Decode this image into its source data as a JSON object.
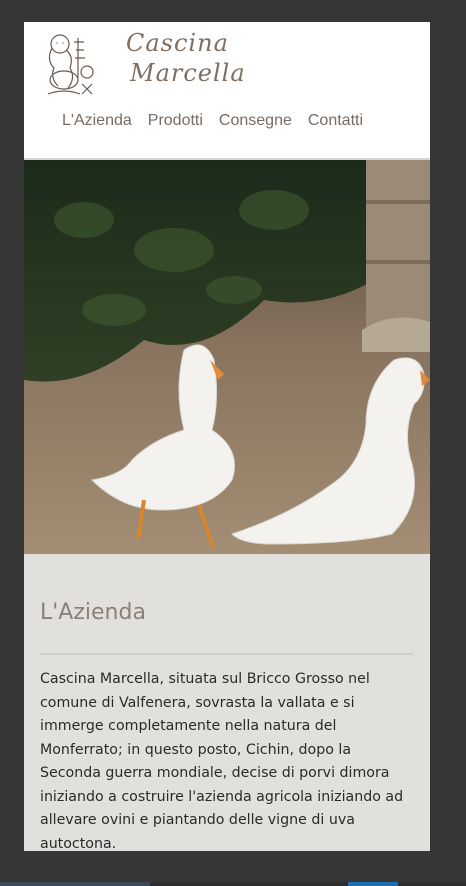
{
  "brand": {
    "line1": "Cascina",
    "line2": "Marcella"
  },
  "nav": {
    "items": [
      "L'Azienda",
      "Prodotti",
      "Consegne",
      "Contatti"
    ]
  },
  "section": {
    "title": "L'Azienda",
    "body": "Cascina Marcella, situata sul Bricco Grosso nel comune di Valfenera, sovrasta la vallata e si immerge completamente nella natura del Monferrato; in questo posto, Cichin, dopo la Seconda guerra mondiale, decise di porvi dimora iniziando a costruire l'azienda agricola iniziando ad allevare ovini e piantando delle vigne di uva autoctona."
  },
  "colors": {
    "page_bg": "#363636",
    "content_bg": "#e2e0dd",
    "brand_text": "#7f6f62",
    "nav_text": "#7a6b60"
  }
}
